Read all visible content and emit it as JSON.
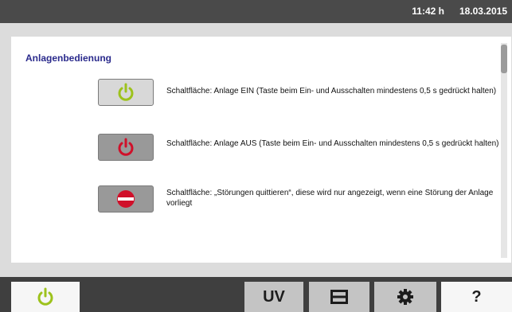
{
  "header": {
    "time": "11:42 h",
    "date": "18.03.2015"
  },
  "panel": {
    "title": "Anlagenbedienung",
    "items": [
      {
        "icon": "power-icon",
        "icon_color": "#9dc21c",
        "description": "Schaltfläche: Anlage EIN (Taste beim Ein- und Ausschalten mindestens 0,5 s gedrückt halten)"
      },
      {
        "icon": "power-icon",
        "icon_color": "#d0102a",
        "description": "Schaltfläche: Anlage AUS (Taste beim Ein- und Ausschalten mindestens 0,5 s gedrückt halten)"
      },
      {
        "icon": "no-entry-icon",
        "icon_color": "#d0102a",
        "description": "Schaltfläche: „Störungen quittieren“, diese wird nur angezeigt, wenn eine Störung der Anlage vorliegt"
      }
    ]
  },
  "bottom_nav": {
    "power_icon_color": "#9dc21c",
    "uv_label": "UV",
    "help_label": "?"
  }
}
